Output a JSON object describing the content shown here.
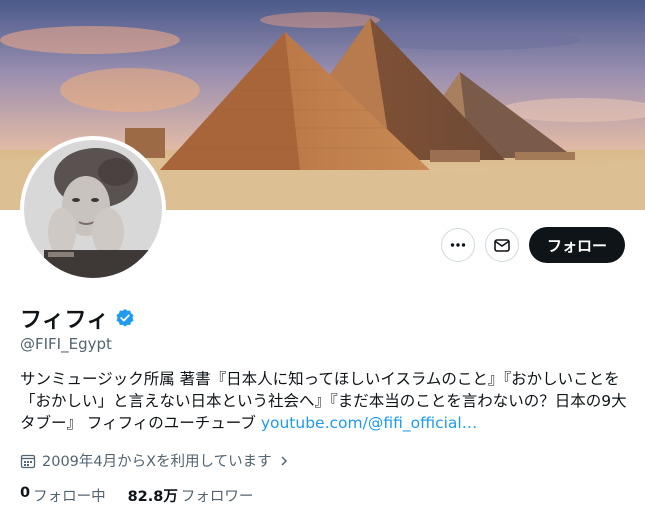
{
  "banner": {
    "description": ""
  },
  "profile": {
    "display_name": "フィフィ",
    "handle": "@FIFI_Egypt",
    "bio_text": "サンミュージック所属 著書『日本人に知ってほしいイスラムのこと』『おかしいことを「おかしい」と言えない日本という社会へ』『まだ本当のことを言わないの？日本の9大タブー』 フィフィのユーチューブ ",
    "bio_link": "youtube.com/@fifi_official…",
    "joined": "2009年4月からXを利用しています",
    "following_count": "0",
    "following_label": "フォロー中",
    "followers_count": "82.8万",
    "followers_label": "フォロワー"
  },
  "actions": {
    "more_icon": "more-icon",
    "message_icon": "message-icon",
    "follow_label": "フォロー"
  },
  "colors": {
    "accent": "#1d9bf0",
    "text": "#0f1419",
    "muted": "#536471",
    "follow_bg": "#0f1419",
    "verified": "#1d9bf0"
  }
}
